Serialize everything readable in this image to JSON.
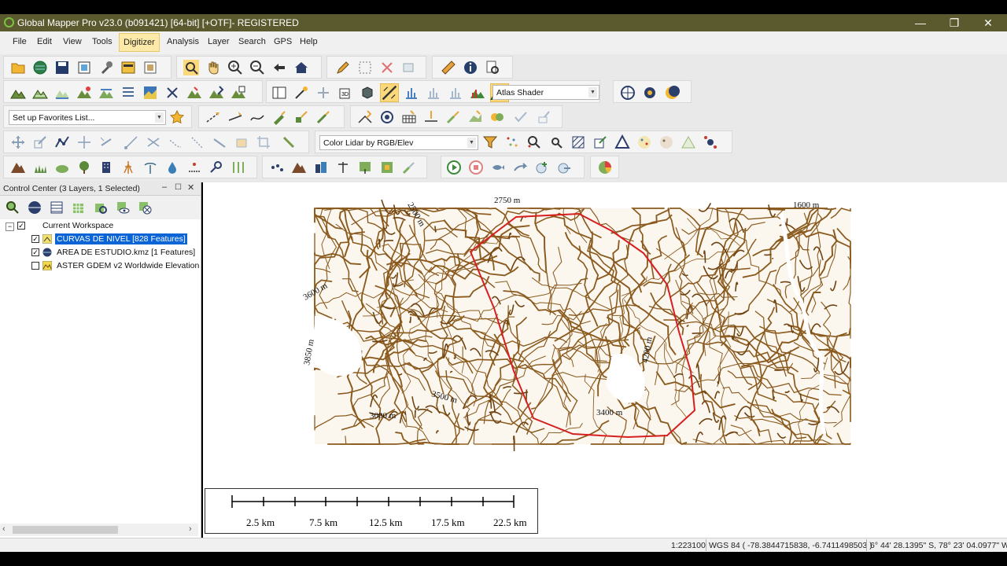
{
  "window": {
    "title": "Global Mapper Pro v23.0 (b091421) [64-bit] [+OTF]- REGISTERED",
    "minimize": "—",
    "maximize": "❐",
    "close": "✕"
  },
  "menu": [
    "File",
    "Edit",
    "View",
    "Tools",
    "Digitizer",
    "Analysis",
    "Layer",
    "Search",
    "GPS",
    "Help"
  ],
  "menu_active": "Digitizer",
  "toolbar": {
    "shader_select": "Atlas Shader",
    "favorites_select": "Set up Favorites List...",
    "lidar_select": "Color Lidar by RGB/Elev"
  },
  "control_center": {
    "title": "Control Center (3 Layers, 1 Selected)",
    "workspace": "Current Workspace",
    "layers": [
      {
        "name": "CURVAS DE NIVEL [828 Features]",
        "checked": true,
        "selected": true
      },
      {
        "name": "AREA DE ESTUDIO.kmz [1 Features]",
        "checked": true,
        "selected": false
      },
      {
        "name": "ASTER GDEM v2 Worldwide Elevation",
        "checked": false,
        "selected": false
      }
    ]
  },
  "map": {
    "contour_color": "#8a5a1e",
    "boundary_color": "#d62020",
    "labels": [
      "2750 m",
      "1600 m",
      "3850 m",
      "3600 m",
      "2500 m",
      "3500 m",
      "3000 m",
      "3400 m",
      "4200 m"
    ],
    "scale_labels": [
      "2.5 km",
      "7.5 km",
      "12.5 km",
      "17.5 km",
      "22.5 km"
    ]
  },
  "status": {
    "scale": "1:223100",
    "coords": "WGS 84 ( -78.3844715838, -6.7411498503 )",
    "dms": "6° 44' 28.1395\" S, 78° 23' 04.0977\" W"
  }
}
